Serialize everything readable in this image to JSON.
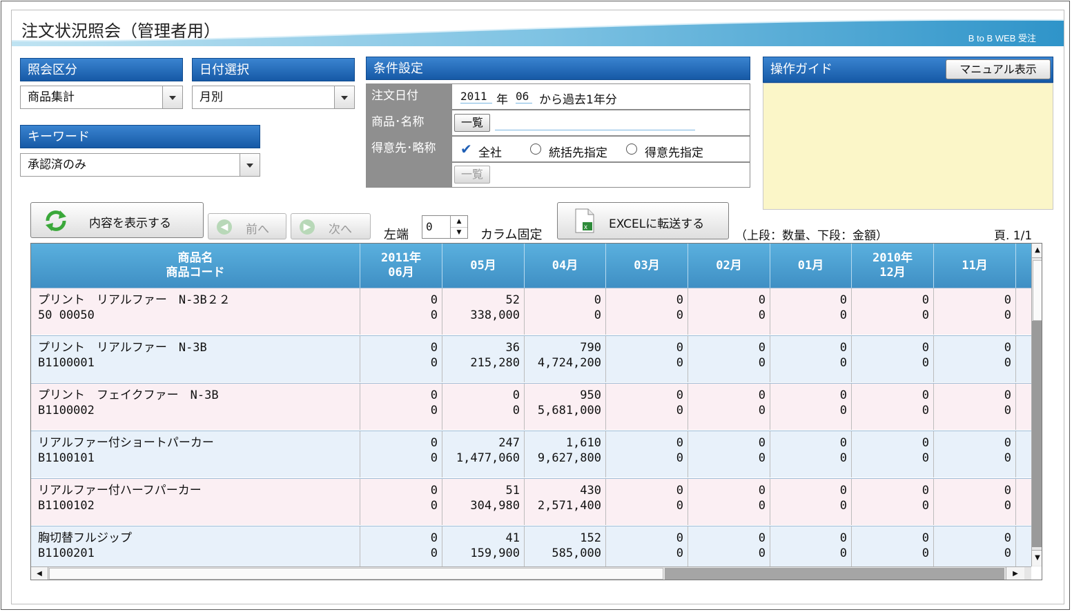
{
  "header": {
    "title": "注文状況照会（管理者用）",
    "brand": "B to B WEB 受注"
  },
  "filters": {
    "inquiry_type_label": "照会区分",
    "inquiry_type_value": "商品集計",
    "date_select_label": "日付選択",
    "date_select_value": "月別",
    "keyword_label": "キーワード",
    "keyword_value": "承認済のみ"
  },
  "conditions": {
    "heading": "条件設定",
    "order_date_label": "注文日付",
    "order_year": "2011",
    "year_label": "年",
    "order_month": "06",
    "order_date_suffix": "から過去1年分",
    "product_label": "商品･名称",
    "list_button": "一覧",
    "customer_label": "得意先･略称",
    "radio_all": "全社",
    "radio_group": "統括先指定",
    "radio_customer": "得意先指定",
    "list_button_disabled": "一覧"
  },
  "guide": {
    "heading": "操作ガイド",
    "manual_button": "マニュアル表示"
  },
  "toolbar": {
    "show_button": "内容を表示する",
    "prev_button": "前へ",
    "next_button": "次へ",
    "left_label": "左端",
    "left_value": "0",
    "fix_label": "カラム固定",
    "excel_button": "EXCELに転送する",
    "legend": "（上段：数量、下段：金額）",
    "page": "頁. 1/1"
  },
  "table": {
    "headers": [
      {
        "l1": "商品名",
        "l2": "商品コード"
      },
      {
        "l1": "2011年",
        "l2": "06月"
      },
      {
        "l1": "",
        "l2": "05月"
      },
      {
        "l1": "",
        "l2": "04月"
      },
      {
        "l1": "",
        "l2": "03月"
      },
      {
        "l1": "",
        "l2": "02月"
      },
      {
        "l1": "",
        "l2": "01月"
      },
      {
        "l1": "2010年",
        "l2": "12月"
      },
      {
        "l1": "",
        "l2": "11月"
      }
    ],
    "rows": [
      {
        "name": "プリント　リアルファー　N-3B２２",
        "code": "50 00050",
        "qty": [
          "0",
          "52",
          "0",
          "0",
          "0",
          "0",
          "0",
          "0"
        ],
        "amt": [
          "0",
          "338,000",
          "0",
          "0",
          "0",
          "0",
          "0",
          "0"
        ]
      },
      {
        "name": "プリント　リアルファー　N-3B",
        "code": "B1100001",
        "qty": [
          "0",
          "36",
          "790",
          "0",
          "0",
          "0",
          "0",
          "0"
        ],
        "amt": [
          "0",
          "215,280",
          "4,724,200",
          "0",
          "0",
          "0",
          "0",
          "0"
        ]
      },
      {
        "name": "プリント　フェイクファー　N-3B",
        "code": "B1100002",
        "qty": [
          "0",
          "0",
          "950",
          "0",
          "0",
          "0",
          "0",
          "0"
        ],
        "amt": [
          "0",
          "0",
          "5,681,000",
          "0",
          "0",
          "0",
          "0",
          "0"
        ]
      },
      {
        "name": "リアルファー付ショートパーカー",
        "code": "B1100101",
        "qty": [
          "0",
          "247",
          "1,610",
          "0",
          "0",
          "0",
          "0",
          "0"
        ],
        "amt": [
          "0",
          "1,477,060",
          "9,627,800",
          "0",
          "0",
          "0",
          "0",
          "0"
        ]
      },
      {
        "name": "リアルファー付ハーフパーカー",
        "code": "B1100102",
        "qty": [
          "0",
          "51",
          "430",
          "0",
          "0",
          "0",
          "0",
          "0"
        ],
        "amt": [
          "0",
          "304,980",
          "2,571,400",
          "0",
          "0",
          "0",
          "0",
          "0"
        ]
      },
      {
        "name": "胸切替フルジップ",
        "code": "B1100201",
        "qty": [
          "0",
          "41",
          "152",
          "0",
          "0",
          "0",
          "0",
          "0"
        ],
        "amt": [
          "0",
          "159,900",
          "585,000",
          "0",
          "0",
          "0",
          "0",
          "0"
        ]
      }
    ]
  }
}
